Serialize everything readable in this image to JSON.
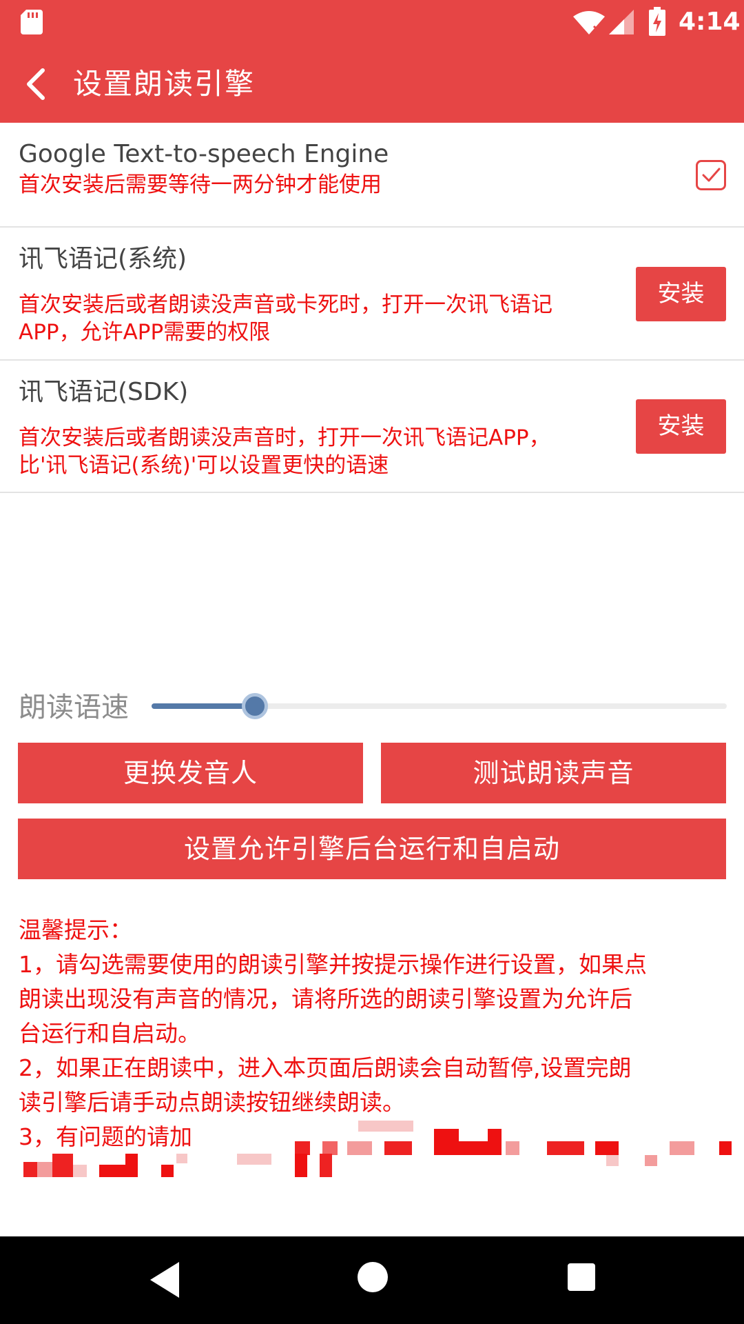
{
  "status_bar": {
    "time": "4:14"
  },
  "header": {
    "title": "设置朗读引擎"
  },
  "engines": [
    {
      "name": "Google Text-to-speech Engine",
      "description": "首次安装后需要等待一两分钟才能使用",
      "checked": true
    },
    {
      "name": "讯飞语记(系统)",
      "description_lines": [
        "首次安装后或者朗读没声音或卡死时，打开一次讯飞语记",
        "APP，允许APP需要的权限"
      ],
      "button_label": "安装"
    },
    {
      "name": "讯飞语记(SDK)",
      "description_lines": [
        "首次安装后或者朗读没声音时，打开一次讯飞语记APP，",
        "比'讯飞语记(系统)'可以设置更快的语速"
      ],
      "button_label": "安装"
    }
  ],
  "speed": {
    "label": "朗读语速",
    "value_fraction": 0.18
  },
  "buttons": {
    "change_voice": "更换发音人",
    "test_voice": "测试朗读声音",
    "allow_background": "设置允许引擎后台运行和自启动"
  },
  "tips": {
    "lines": [
      "温馨提示：",
      "1，请勾选需要使用的朗读引擎并按提示操作进行设置，如果点",
      "朗读出现没有声音的情况，请将所选的朗读引擎设置为允许后",
      "台运行和自启动。",
      "2，如果正在朗读中，进入本页面后朗读会自动暂停,设置完朗",
      "读引擎后请手动点朗读按钮继续朗读。",
      "3，有问题的请加"
    ]
  },
  "colors": {
    "accent": "#e64545",
    "warning_text": "#ee1111",
    "slider": "#5479a8"
  }
}
